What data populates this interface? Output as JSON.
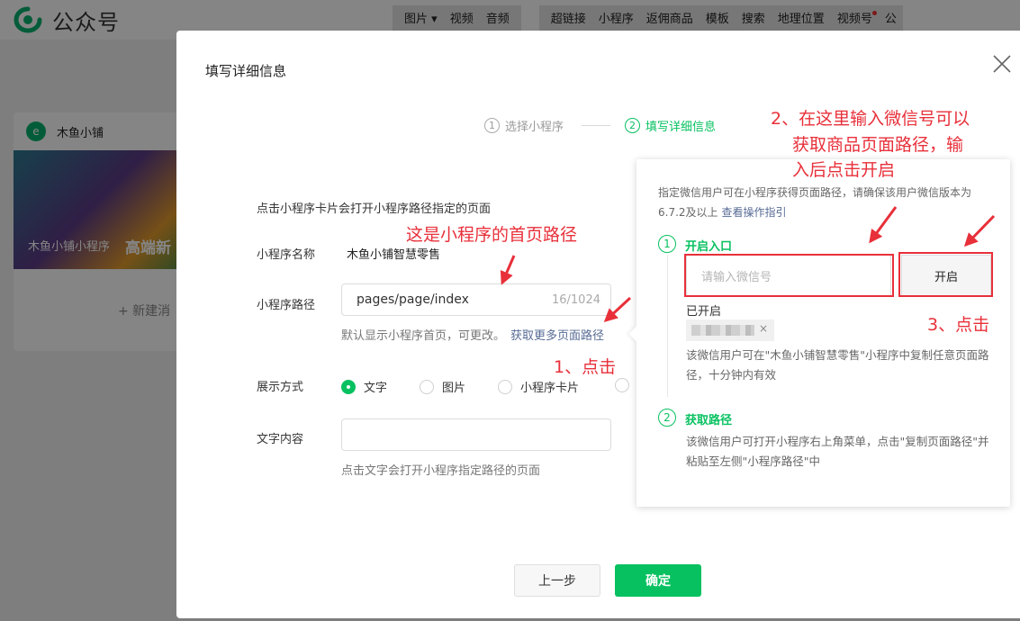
{
  "app": {
    "brand": "公众号",
    "toolbar_group1": [
      "图片",
      "视频",
      "音频"
    ],
    "toolbar_group2": [
      "超链接",
      "小程序",
      "返佣商品",
      "模板",
      "搜索",
      "地理位置",
      "视频号",
      "公"
    ]
  },
  "background_card": {
    "avatar_letter": "e",
    "name": "木鱼小铺",
    "image_text_left": "木鱼小铺小程序",
    "image_text_right": "高端新",
    "new_message": "+ 新建消"
  },
  "modal": {
    "title": "填写详细信息",
    "steps": [
      {
        "num": "1",
        "label": "选择小程序"
      },
      {
        "num": "2",
        "label": "填写详细信息"
      }
    ],
    "intro": "点击小程序卡片会打开小程序路径指定的页面",
    "appname_label": "小程序名称",
    "appname_value": "木鱼小铺智慧零售",
    "path_label": "小程序路径",
    "path_value": "pages/page/index",
    "path_count": "16/1024",
    "path_hint": "默认显示小程序首页，可更改。",
    "path_more_link": "获取更多页面路径",
    "display_label": "展示方式",
    "display_options": [
      "文字",
      "图片",
      "小程序卡片"
    ],
    "display_selected": "文字",
    "text_label": "文字内容",
    "text_value": "",
    "text_hint": "点击文字会打开小程序指定路径的页面",
    "btn_prev": "上一步",
    "btn_ok": "确定"
  },
  "popover": {
    "desc": "指定微信用户可在小程序获得页面路径，请确保该用户微信版本为6.7.2及以上",
    "guide_link": "查看操作指引",
    "step1_num": "1",
    "step1_title": "开启入口",
    "wx_placeholder": "请输入微信号",
    "btn_enable": "开启",
    "enabled_label": "已开启",
    "chip_close": "×",
    "step1_desc": "该微信用户可在\"木鱼小铺智慧零售\"小程序中复制任意页面路径，十分钟内有效",
    "step2_num": "2",
    "step2_title": "获取路径",
    "step2_desc": "该微信用户可打开小程序右上角菜单，点击\"复制页面路径\"并粘贴至左侧\"小程序路径\"中"
  },
  "annotations": {
    "a1": "这是小程序的首页路径",
    "a2_line1": "2、在这里输入微信号可以",
    "a2_line2": "获取商品页面路径，输",
    "a2_line3": "入后点击开启",
    "a3": "3、点击",
    "a4": "1、点击"
  },
  "colors": {
    "accent_green": "#07c160",
    "link_blue": "#576b95",
    "annotation_red": "#e8303a"
  }
}
